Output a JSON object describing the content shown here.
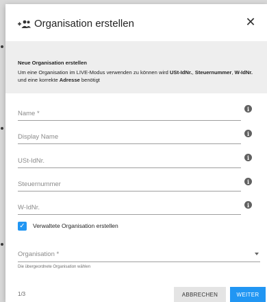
{
  "dialog": {
    "title": "Organisation erstellen",
    "title_icon": "add-group-icon",
    "close_icon": "close-icon",
    "close_glyph": "✕"
  },
  "info": {
    "heading": "Neue Organisation erstellen",
    "text_1": "Um eine Organisation im LIVE-Modus verwenden zu können wird ",
    "bold_1": "USt-IdNr.",
    "text_2": ", ",
    "bold_2": "Steuernummer",
    "text_3": ", ",
    "bold_3": "W-IdNr.",
    "text_4": " und eine korrekte ",
    "bold_4": "Adresse",
    "text_5": " benötigt"
  },
  "fields": [
    {
      "placeholder": "Name *",
      "value": ""
    },
    {
      "placeholder": "Display Name",
      "value": ""
    },
    {
      "placeholder": "USt-IdNr.",
      "value": ""
    },
    {
      "placeholder": "Steuernummer",
      "value": ""
    },
    {
      "placeholder": "W-IdNr.",
      "value": ""
    }
  ],
  "info_glyph": "i",
  "checkbox": {
    "label": "Verwaltete Organisation erstellen",
    "checked": true,
    "glyph": "✓"
  },
  "organisation_select": {
    "placeholder": "Organisation *",
    "helper": "Die übergeordnete Organisation wählen"
  },
  "footer": {
    "page_indicator": "1/3",
    "cancel_label": "ABBRECHEN",
    "next_label": "WEITER"
  },
  "colors": {
    "accent": "#2196f3",
    "info_bg": "#eeeeee"
  }
}
